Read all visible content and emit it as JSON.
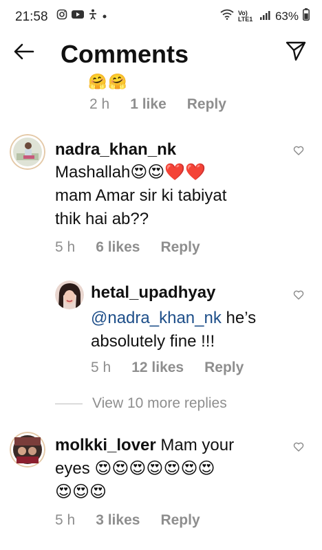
{
  "status": {
    "time": "21:58",
    "network": "Vo) LTE1",
    "battery": "63%"
  },
  "header": {
    "title": "Comments"
  },
  "previous_comment": {
    "emojis": "🤗🤗",
    "time": "2 h",
    "likes": "1 like",
    "reply": "Reply"
  },
  "comments": [
    {
      "username": "nadra_khan_nk",
      "lines": [
        "Mashallah😍😍❤️❤️",
        "mam Amar sir ki tabiyat",
        "thik hai ab??"
      ],
      "time": "5 h",
      "likes": "6 likes",
      "reply": "Reply"
    },
    {
      "username": "hetal_upadhyay",
      "mention": "@nadra_khan_nk",
      "text_after_mention": " he’s",
      "line2": "absolutely fine !!!",
      "time": "5 h",
      "likes": "12 likes",
      "reply": "Reply"
    },
    {
      "username": "molkki_lover",
      "text_inline": "Mam your",
      "line2": "eyes 😍😍😍😍😍😍😍",
      "line3": "😍😍😍",
      "time": "5 h",
      "likes": "3 likes",
      "reply": "Reply"
    }
  ],
  "view_more": "View 10 more replies"
}
